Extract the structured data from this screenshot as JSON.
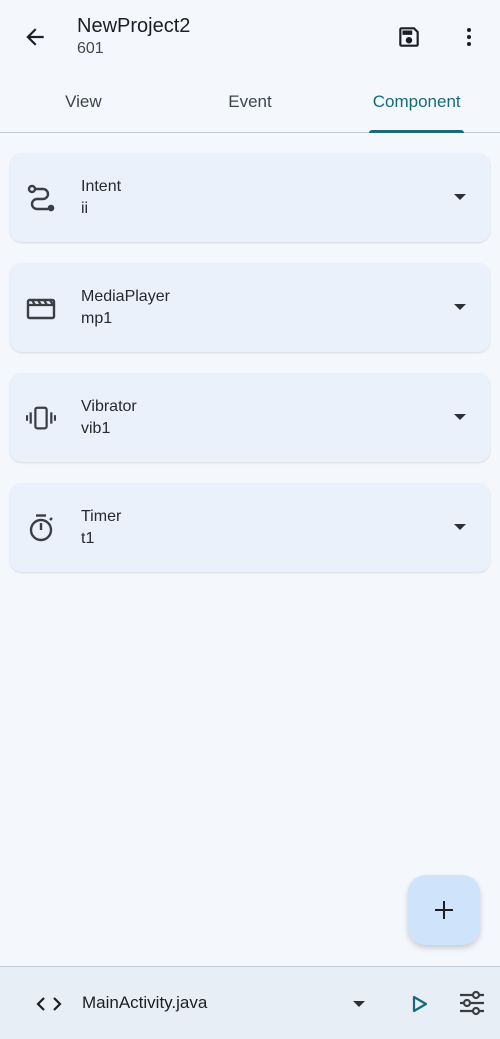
{
  "appbar": {
    "title": "NewProject2",
    "subtitle": "601",
    "back_icon": "arrow-back-icon",
    "save_icon": "save-icon",
    "more_icon": "more-vert-icon"
  },
  "tabs": [
    {
      "label": "View",
      "active": false
    },
    {
      "label": "Event",
      "active": false
    },
    {
      "label": "Component",
      "active": true
    }
  ],
  "components": [
    {
      "type": "Intent",
      "id": "ii",
      "icon": "route-icon"
    },
    {
      "type": "MediaPlayer",
      "id": "mp1",
      "icon": "movie-icon"
    },
    {
      "type": "Vibrator",
      "id": "vib1",
      "icon": "vibration-icon"
    },
    {
      "type": "Timer",
      "id": "t1",
      "icon": "timer-icon"
    }
  ],
  "fab": {
    "icon": "add-icon"
  },
  "bottombar": {
    "code_icon": "code-icon",
    "file": "MainActivity.java",
    "run_icon": "play-icon",
    "tune_icon": "tune-icon"
  },
  "colors": {
    "accent": "#176a7a",
    "background": "#f4f8fd",
    "card": "#eaf1fa",
    "fab": "#cfe4fb"
  }
}
